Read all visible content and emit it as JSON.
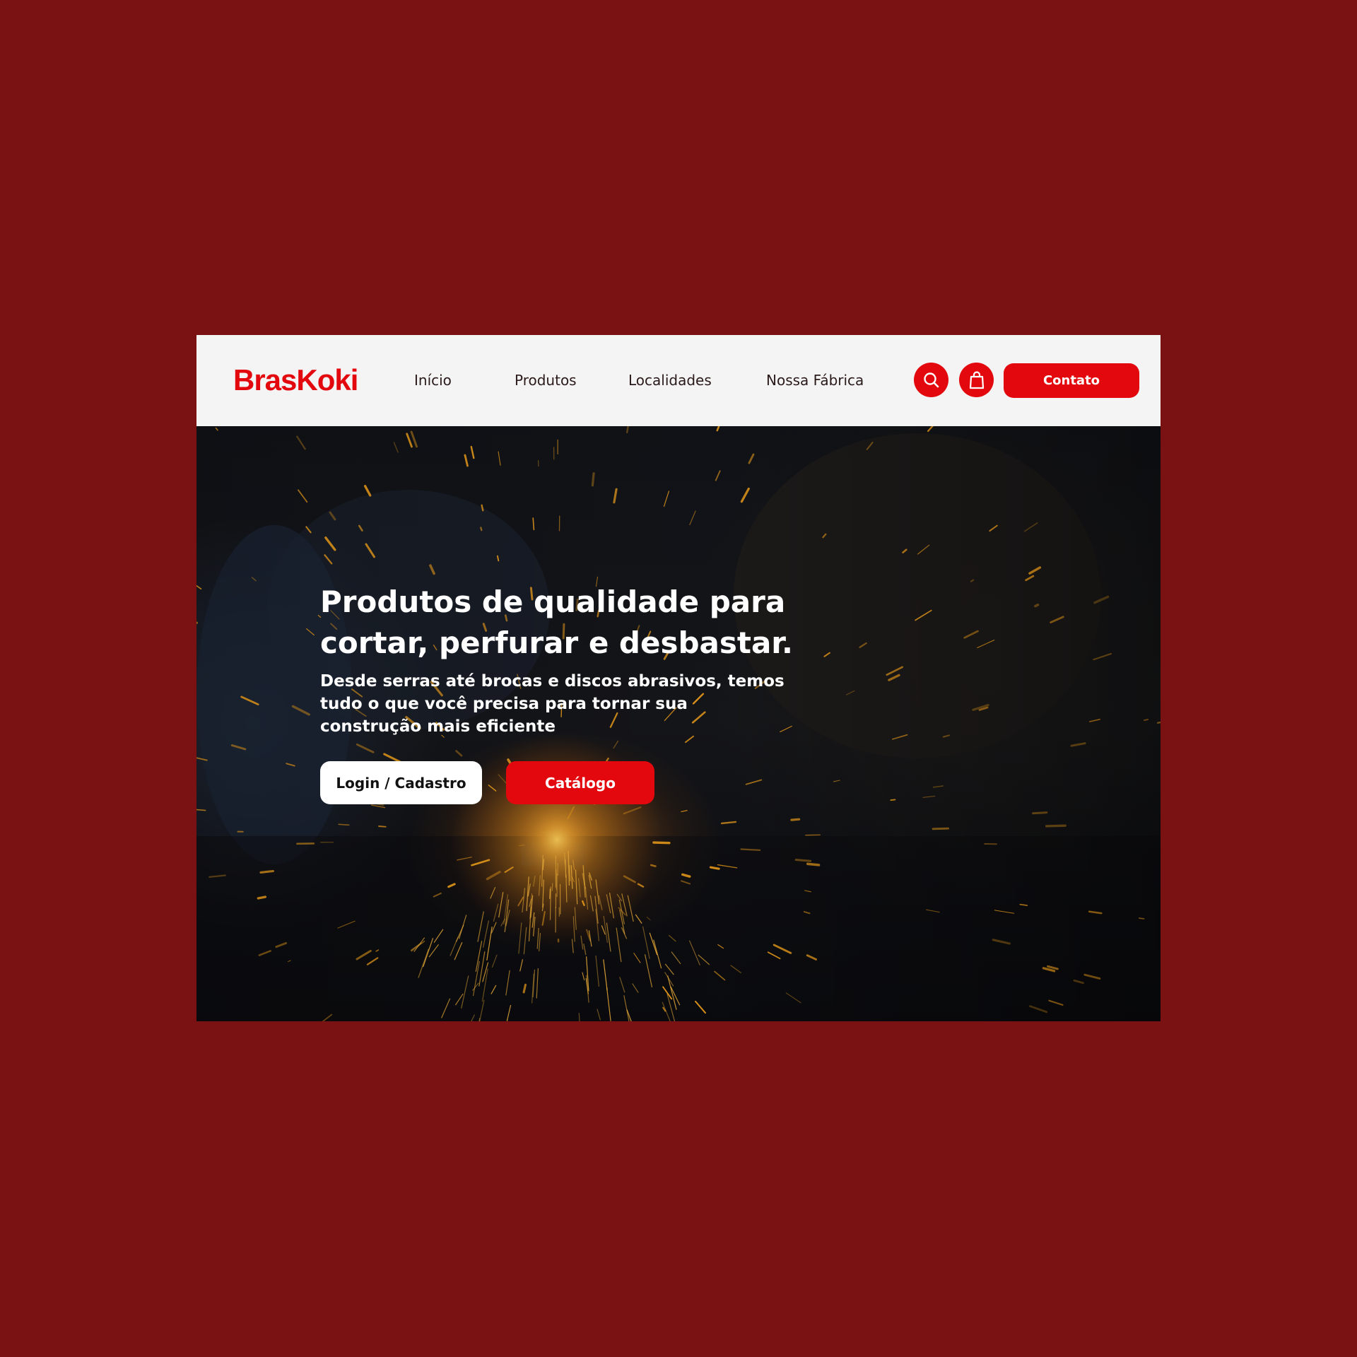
{
  "brand": {
    "name": "BrasKoki",
    "color": "#e3080d",
    "page_background": "#7a1214"
  },
  "nav": {
    "links": [
      "Início",
      "Produtos",
      "Localidades",
      "Nossa Fábrica"
    ],
    "search_icon": "search-icon",
    "cart_icon": "shopping-bag-icon",
    "contact_label": "Contato"
  },
  "hero": {
    "title_line1": "Produtos de qualidade para",
    "title_line2": "cortar, perfurar e desbastar.",
    "subtitle_line1": "Desde serras até brocas e discos abrasivos, temos",
    "subtitle_line2": "tudo o que você precisa para tornar sua",
    "subtitle_line3": "construção mais eficiente",
    "login_label": "Login / Cadastro",
    "catalog_label": "Catálogo",
    "background": "dark photo of grinding sparks",
    "spark_color": "#f3a21c"
  }
}
